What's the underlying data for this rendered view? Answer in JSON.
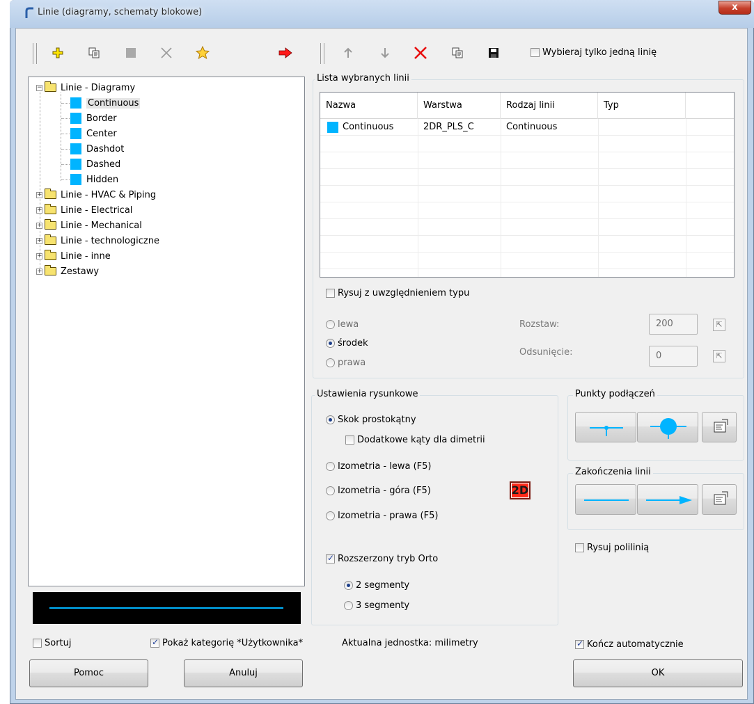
{
  "window": {
    "title": "Linie (diagramy, schematy blokowe)",
    "close_glyph": "x"
  },
  "colors": {
    "line_color": "#00b4ff",
    "badge": "#ff2a1a"
  },
  "toolbar_left": {
    "icons": [
      "add-icon",
      "copy-icon",
      "stop-icon",
      "delete-icon",
      "favorite-star-icon",
      "transfer-right-arrow-icon"
    ]
  },
  "toolbar_right": {
    "icons": [
      "move-up-arrow-icon",
      "move-down-arrow-icon",
      "delete-red-x-icon",
      "copy-icon",
      "save-disk-icon"
    ],
    "single_line_checkbox": {
      "label": "Wybieraj tylko jedną linię",
      "checked": false
    }
  },
  "tree": {
    "groups": [
      {
        "label": "Linie - Diagramy",
        "expanded": true,
        "children": [
          "Continuous",
          "Border",
          "Center",
          "Dashdot",
          "Dashed",
          "Hidden"
        ]
      },
      {
        "label": "Linie - HVAC & Piping",
        "expanded": false
      },
      {
        "label": "Linie - Electrical",
        "expanded": false
      },
      {
        "label": "Linie - Mechanical",
        "expanded": false
      },
      {
        "label": "Linie - technologiczne",
        "expanded": false
      },
      {
        "label": "Linie - inne",
        "expanded": false
      },
      {
        "label": "Zestawy",
        "expanded": false
      }
    ],
    "selected": "Continuous"
  },
  "selected_lines": {
    "group_title": "Lista wybranych linii",
    "columns": [
      "Nazwa",
      "Warstwa",
      "Rodzaj linii",
      "Typ"
    ],
    "rows": [
      {
        "name": "Continuous",
        "layer": "2DR_PLS_C",
        "linetype": "Continuous",
        "type": ""
      }
    ]
  },
  "draw_with_type": {
    "label": "Rysuj z uwzględnieniem typu",
    "checked": false
  },
  "alignment": {
    "options": [
      "lewa",
      "środek",
      "prawa"
    ],
    "selected": "środek"
  },
  "spacing": {
    "label": "Rozstaw:",
    "value": "200"
  },
  "offset": {
    "label": "Odsunięcie:",
    "value": "0"
  },
  "drawing_settings": {
    "group_title": "Ustawienia rysunkowe",
    "modes": [
      "Skok prostokątny",
      "Izometria - lewa (F5)",
      "Izometria - góra (F5)",
      "Izometria - prawa (F5)"
    ],
    "selected_mode": "Skok prostokątny",
    "dimetry_checkbox": {
      "label": "Dodatkowe kąty dla dimetrii",
      "checked": false
    },
    "badge": "2D",
    "ortho_checkbox": {
      "label": "Rozszerzony tryb Orto",
      "checked": true
    },
    "segments": [
      "2 segmenty",
      "3 segmenty"
    ],
    "selected_segments": "2 segmenty"
  },
  "connection_points": {
    "group_title": "Punkty podłączeń"
  },
  "line_ends": {
    "group_title": "Zakończenia linii"
  },
  "polyline_checkbox": {
    "label": "Rysuj polilinią",
    "checked": false
  },
  "bottom": {
    "sort_checkbox": {
      "label": "Sortuj",
      "checked": false
    },
    "user_category_checkbox": {
      "label": "Pokaż kategorię *Użytkownika*",
      "checked": true
    },
    "units_text": "Aktualna jednostka: milimetry",
    "auto_finish_checkbox": {
      "label": "Kończ automatycznie",
      "checked": true
    },
    "help_button": "Pomoc",
    "cancel_button": "Anuluj",
    "ok_button": "OK"
  }
}
